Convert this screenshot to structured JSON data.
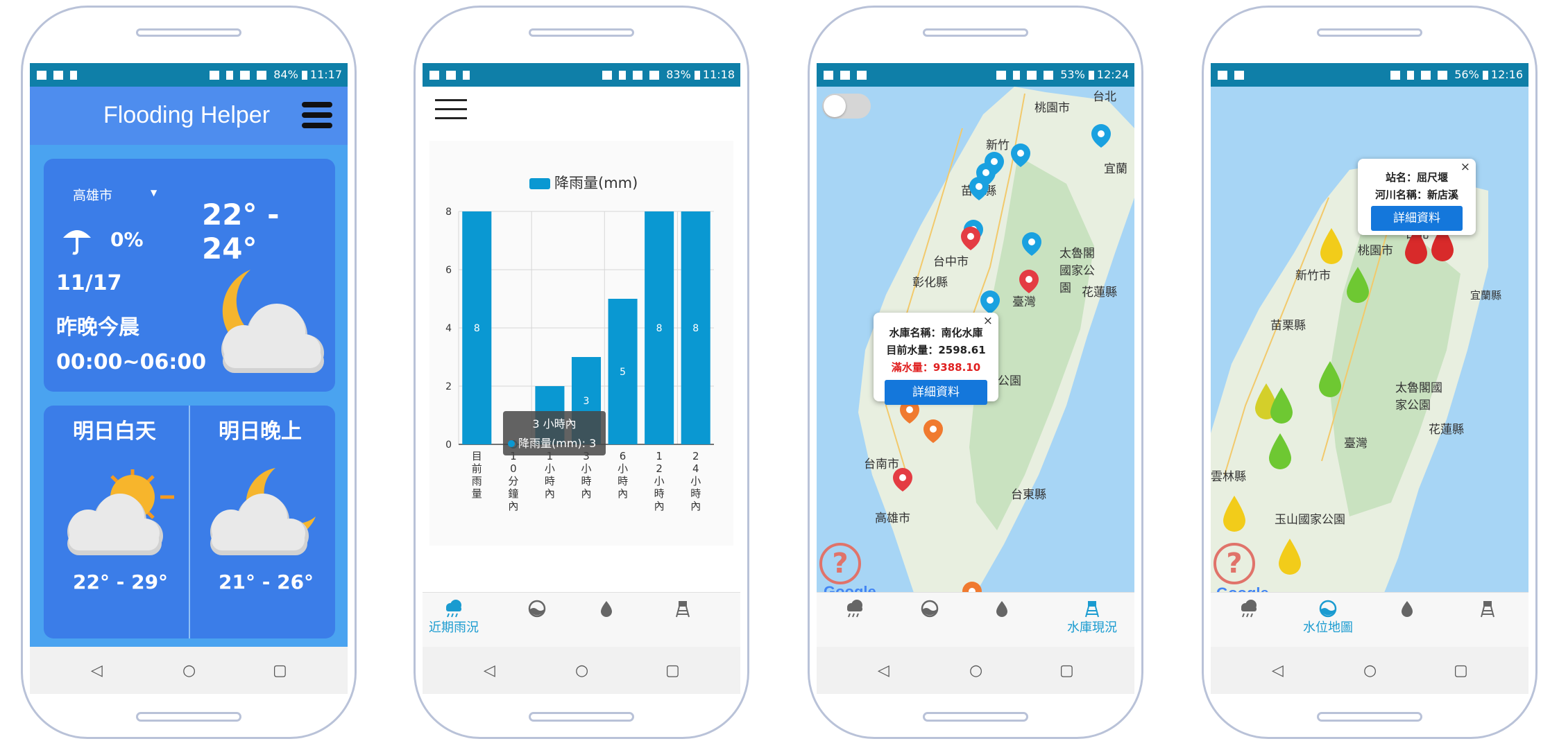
{
  "phone1": {
    "status": {
      "battery": "84%",
      "time": "11:17"
    },
    "app_title": "Flooding Helper",
    "location": "高雄市",
    "rain_chance": "0%",
    "temp_range": "22° - 24°",
    "date": "11/17",
    "period": "昨晚今晨",
    "period_time": "00:00~06:00",
    "tomorrow_day": {
      "label": "明日白天",
      "temp": "22° - 29°"
    },
    "tomorrow_night": {
      "label": "明日晚上",
      "temp": "21° - 26°"
    }
  },
  "phone2": {
    "status": {
      "battery": "83%",
      "time": "11:18"
    },
    "tooltip": {
      "title": "3 小時內",
      "series": "降雨量(mm): 3"
    },
    "bottom_nav": [
      "近期雨況",
      "",
      "",
      ""
    ]
  },
  "phone3": {
    "status": {
      "battery": "53%",
      "time": "12:24"
    },
    "popup": {
      "name": "水庫名稱：南化水庫",
      "current": "目前水量：2598.61",
      "full": "滿水量：9388.10",
      "button": "詳細資料",
      "close": "×"
    },
    "labels": [
      "桃園市",
      "台北",
      "新竹",
      "苗栗縣",
      "宜蘭",
      "台中市",
      "彰化縣",
      "太魯閣國家公園",
      "臺灣",
      "花蓮縣",
      "家公園",
      "台南市",
      "高雄市",
      "台東縣"
    ],
    "google": "Google",
    "help": "?",
    "bottom_nav": [
      "",
      "",
      "",
      "水庫現況"
    ],
    "colors": {
      "blue_marker": "#1aa1e0",
      "red_marker": "#e43c43",
      "orange_marker": "#f07a2f"
    }
  },
  "phone4": {
    "status": {
      "battery": "56%",
      "time": "12:16"
    },
    "popup": {
      "station": "站名：屈尺堰",
      "river": "河川名稱：新店溪",
      "button": "詳細資料",
      "close": "×"
    },
    "labels": [
      "桃園市",
      "台北",
      "新竹市",
      "宜蘭縣",
      "苗栗縣",
      "太魯閣國家公園",
      "花蓮縣",
      "臺灣",
      "雲林縣",
      "玉山國家公園"
    ],
    "google": "Google",
    "help": "?",
    "bottom_nav": [
      "",
      "水位地圖",
      "",
      ""
    ]
  },
  "chart_data": {
    "type": "bar",
    "legend": "降雨量(mm)",
    "categories": [
      "目前雨量",
      "10分鐘內",
      "1小時內",
      "3小時內",
      "6小時內",
      "12小時內",
      "24小時內"
    ],
    "values": [
      8,
      0,
      2,
      3,
      5,
      8,
      8
    ],
    "ylim": [
      0,
      8
    ],
    "yticks": [
      0,
      2,
      4,
      6,
      8
    ],
    "data_labels": [
      "8",
      "",
      "",
      "3",
      "5",
      "8",
      "8"
    ],
    "grid": true,
    "color": "#0a98d2"
  }
}
